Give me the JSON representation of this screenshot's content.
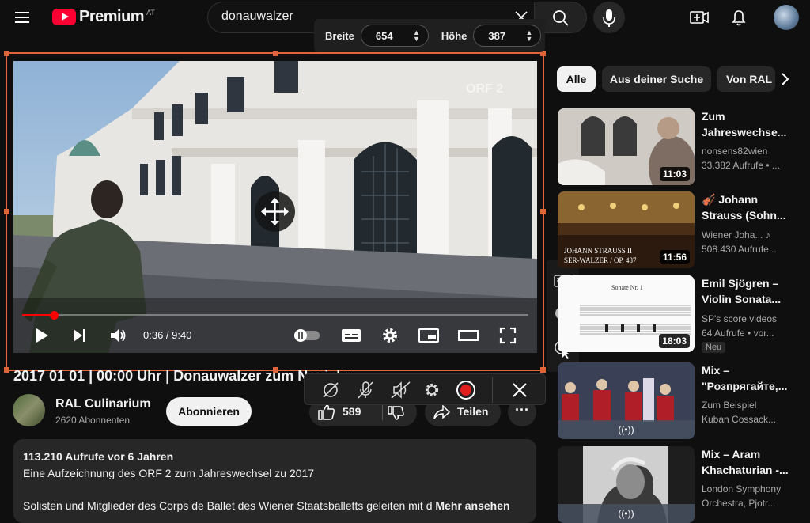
{
  "header": {
    "logo_text": "Premium",
    "region": "AT",
    "search_value": "donauwalzer"
  },
  "size_toolbar": {
    "width_label": "Breite",
    "width_value": "654",
    "height_label": "Höhe",
    "height_value": "387"
  },
  "player": {
    "time": "0:36 / 9:40",
    "progress": 0.062,
    "watermark": "ORF 2"
  },
  "video": {
    "title": "2017 01 01 | 00:00 Uhr | Donauwalzer zum Neujahr",
    "channel_name": "RAL Culinarium",
    "channel_subs": "2620 Abonnenten",
    "subscribe_label": "Abonnieren",
    "like_count": "589",
    "share_label": "Teilen",
    "more_label": "···"
  },
  "description": {
    "stats": "113.210 Aufrufe  vor 6 Jahren",
    "line1": "Eine Aufzeichnung des ORF 2 zum Jahreswechsel zu 2017",
    "line2": "Solisten und Mitglieder des Corps de Ballet des Wiener Staatsballetts geleiten mit d",
    "more_link": "Mehr ansehen"
  },
  "chips": [
    "Alle",
    "Aus deiner Suche",
    "Von RAL"
  ],
  "recommendations": [
    {
      "title": "Zum Jahreswechse...",
      "channel": "nonsens82wien",
      "meta": "33.382 Aufrufe • ...",
      "duration": "11:03"
    },
    {
      "title": "🎻 Johann Strauss (Sohn...",
      "channel": "Wiener Joha... ♪",
      "meta": "508.430 Aufrufe...",
      "duration": "11:56",
      "thumb_text": "JOHANN STRAUSS II",
      "thumb_text2": "SER-WALZER / OP. 437"
    },
    {
      "title": "Emil Sjögren – Violin Sonata...",
      "channel": "SP's score videos",
      "meta": "64 Aufrufe  • vor...",
      "duration": "18:03",
      "badge": "Neu",
      "thumb_text": "Sonate Nr. 1"
    },
    {
      "title": "Mix – \"Розпрягайте,...",
      "channel": "Zum Beispiel",
      "meta": "Kuban Cossack...",
      "live": "((•))"
    },
    {
      "title": "Mix – Aram Khachaturian -...",
      "channel": "London Symphony",
      "meta": "Orchestra, Pjotr...",
      "live": "((•))"
    }
  ]
}
